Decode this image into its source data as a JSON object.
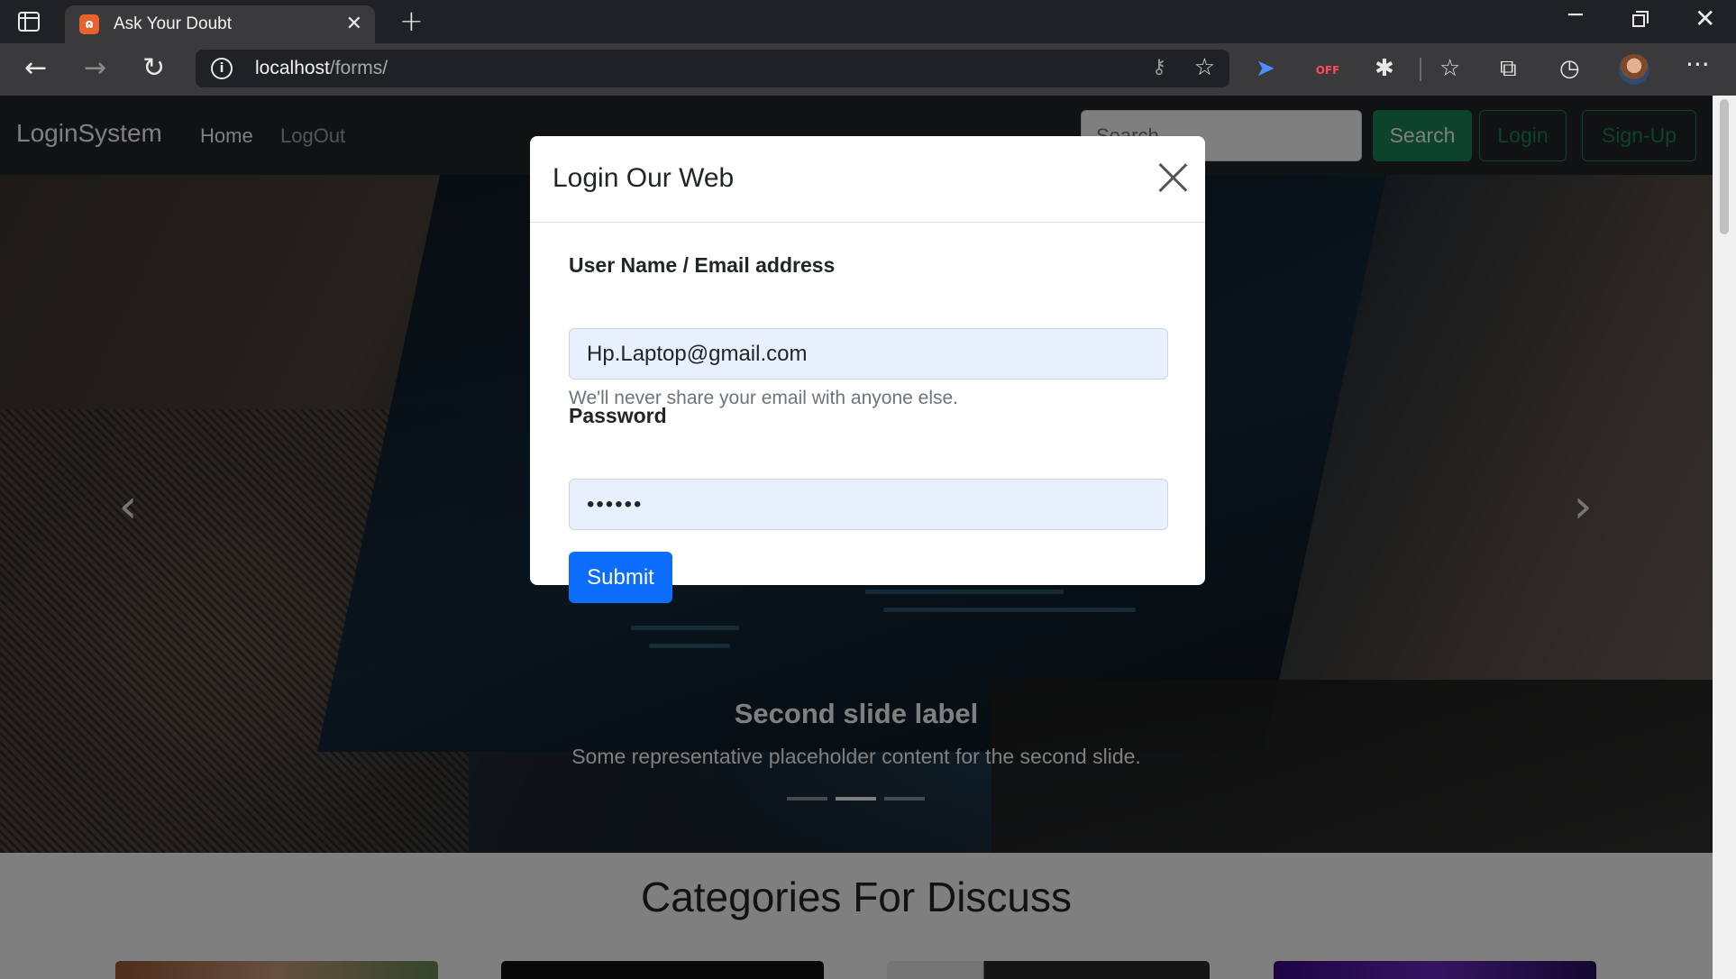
{
  "browser": {
    "tab_title": "Ask Your Doubt",
    "favicon_text": "ɷ",
    "new_tab_glyph": "+",
    "url_host": "localhost",
    "url_path": "/forms/",
    "ext_off_label": "OFF"
  },
  "navbar": {
    "brand": "LoginSystem",
    "links": [
      "Home",
      "LogOut"
    ],
    "search_placeholder": "Search",
    "search_button": "Search",
    "login_button": "Login",
    "signup_button": "Sign-Up",
    "accent_color": "#198754"
  },
  "carousel": {
    "caption_title": "Second slide label",
    "caption_text": "Some representative placeholder content for the second slide.",
    "slide_count": 3,
    "active_slide": 2
  },
  "section": {
    "heading": "Categories For Discuss"
  },
  "modal": {
    "title": "Login Our Web",
    "email_label": "User Name / Email address",
    "email_value": "Hp.Laptop@gmail.com",
    "email_help": "We'll never share your email with anyone else.",
    "password_label": "Password",
    "password_value": "••••••",
    "submit_label": "Submit",
    "submit_color": "#0d6efd"
  }
}
